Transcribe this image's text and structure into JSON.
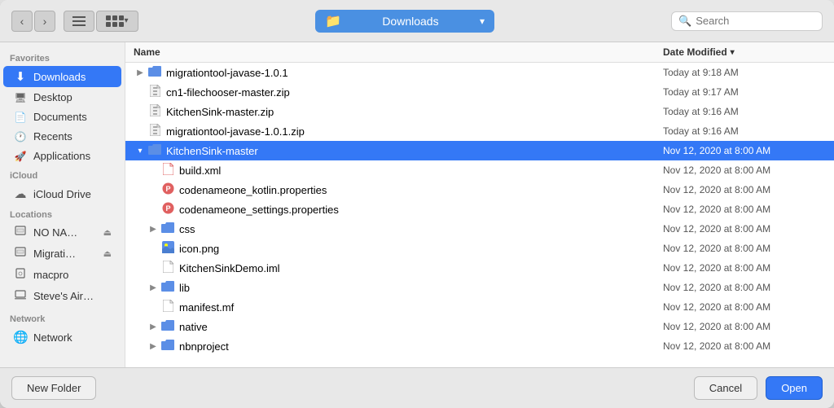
{
  "dialog": {
    "title": "Downloads"
  },
  "toolbar": {
    "back_label": "‹",
    "forward_label": "›",
    "list_view_label": "≡",
    "grid_view_label": "⊞",
    "location_name": "Downloads",
    "search_placeholder": "Search"
  },
  "sidebar": {
    "sections": [
      {
        "label": "Favorites",
        "items": [
          {
            "id": "downloads",
            "label": "Downloads",
            "icon": "⬇",
            "active": true
          },
          {
            "id": "desktop",
            "label": "Desktop",
            "icon": "🖥",
            "active": false
          },
          {
            "id": "documents",
            "label": "Documents",
            "icon": "📄",
            "active": false
          },
          {
            "id": "recents",
            "label": "Recents",
            "icon": "🕐",
            "active": false
          },
          {
            "id": "applications",
            "label": "Applications",
            "icon": "🚀",
            "active": false
          }
        ]
      },
      {
        "label": "iCloud",
        "items": [
          {
            "id": "icloud-drive",
            "label": "iCloud Drive",
            "icon": "☁",
            "active": false
          }
        ]
      },
      {
        "label": "Locations",
        "items": [
          {
            "id": "no-name",
            "label": "NO NA…",
            "icon": "💾",
            "active": false,
            "eject": true
          },
          {
            "id": "migrati",
            "label": "Migrati…",
            "icon": "💾",
            "active": false,
            "eject": true
          },
          {
            "id": "macpro",
            "label": "macpro",
            "icon": "🖥",
            "active": false
          },
          {
            "id": "steves-air",
            "label": "Steve's Air…",
            "icon": "💻",
            "active": false
          }
        ]
      },
      {
        "label": "Network",
        "items": [
          {
            "id": "network",
            "label": "Network",
            "icon": "🌐",
            "active": false
          }
        ]
      }
    ]
  },
  "file_list": {
    "col_name": "Name",
    "col_date": "Date Modified",
    "rows": [
      {
        "id": "migrationtool-dir",
        "indent": 0,
        "expandable": true,
        "expanded": false,
        "icon": "📁",
        "icon_color": "#6b9de8",
        "name": "migrationtool-javase-1.0.1",
        "date": "Today at 9:18 AM",
        "selected": false
      },
      {
        "id": "cn1-zip",
        "indent": 0,
        "expandable": false,
        "expanded": false,
        "icon": "🗜",
        "icon_color": "#aaa",
        "name": "cn1-filechooser-master.zip",
        "date": "Today at 9:17 AM",
        "selected": false
      },
      {
        "id": "kitchensink-zip",
        "indent": 0,
        "expandable": false,
        "expanded": false,
        "icon": "🗜",
        "icon_color": "#aaa",
        "name": "KitchenSink-master.zip",
        "date": "Today at 9:16 AM",
        "selected": false
      },
      {
        "id": "migrationtool-zip",
        "indent": 0,
        "expandable": false,
        "expanded": false,
        "icon": "🗜",
        "icon_color": "#aaa",
        "name": "migrationtool-javase-1.0.1.zip",
        "date": "Today at 9:16 AM",
        "selected": false
      },
      {
        "id": "kitchensink-master",
        "indent": 0,
        "expandable": true,
        "expanded": true,
        "icon": "📁",
        "icon_color": "#6b9de8",
        "name": "KitchenSink-master",
        "date": "Nov 12, 2020 at 8:00 AM",
        "selected": true
      },
      {
        "id": "build-xml",
        "indent": 1,
        "expandable": false,
        "expanded": false,
        "icon": "📄",
        "icon_color": "#e88",
        "name": "build.xml",
        "date": "Nov 12, 2020 at 8:00 AM",
        "selected": false
      },
      {
        "id": "codenameone-kotlin",
        "indent": 1,
        "expandable": false,
        "expanded": false,
        "icon": "⚙",
        "icon_color": "#e88",
        "name": "codenameone_kotlin.properties",
        "date": "Nov 12, 2020 at 8:00 AM",
        "selected": false
      },
      {
        "id": "codenameone-settings",
        "indent": 1,
        "expandable": false,
        "expanded": false,
        "icon": "⚙",
        "icon_color": "#e88",
        "name": "codenameone_settings.properties",
        "date": "Nov 12, 2020 at 8:00 AM",
        "selected": false
      },
      {
        "id": "css-dir",
        "indent": 1,
        "expandable": true,
        "expanded": false,
        "icon": "📁",
        "icon_color": "#6b9de8",
        "name": "css",
        "date": "Nov 12, 2020 at 8:00 AM",
        "selected": false
      },
      {
        "id": "icon-png",
        "indent": 1,
        "expandable": false,
        "expanded": false,
        "icon": "🖼",
        "icon_color": "#aaa",
        "name": "icon.png",
        "date": "Nov 12, 2020 at 8:00 AM",
        "selected": false
      },
      {
        "id": "kitchensink-iml",
        "indent": 1,
        "expandable": false,
        "expanded": false,
        "icon": "📄",
        "icon_color": "#aaa",
        "name": "KitchenSinkDemo.iml",
        "date": "Nov 12, 2020 at 8:00 AM",
        "selected": false
      },
      {
        "id": "lib-dir",
        "indent": 1,
        "expandable": true,
        "expanded": false,
        "icon": "📁",
        "icon_color": "#6b9de8",
        "name": "lib",
        "date": "Nov 12, 2020 at 8:00 AM",
        "selected": false
      },
      {
        "id": "manifest-mf",
        "indent": 1,
        "expandable": false,
        "expanded": false,
        "icon": "📄",
        "icon_color": "#aaa",
        "name": "manifest.mf",
        "date": "Nov 12, 2020 at 8:00 AM",
        "selected": false
      },
      {
        "id": "native-dir",
        "indent": 1,
        "expandable": true,
        "expanded": false,
        "icon": "📁",
        "icon_color": "#6b9de8",
        "name": "native",
        "date": "Nov 12, 2020 at 8:00 AM",
        "selected": false
      },
      {
        "id": "nbnproject-dir",
        "indent": 1,
        "expandable": true,
        "expanded": false,
        "icon": "📁",
        "icon_color": "#6b9de8",
        "name": "nbnproject",
        "date": "Nov 12, 2020 at 8:00 AM",
        "selected": false
      }
    ]
  },
  "bottom_bar": {
    "new_folder_label": "New Folder",
    "cancel_label": "Cancel",
    "open_label": "Open"
  }
}
